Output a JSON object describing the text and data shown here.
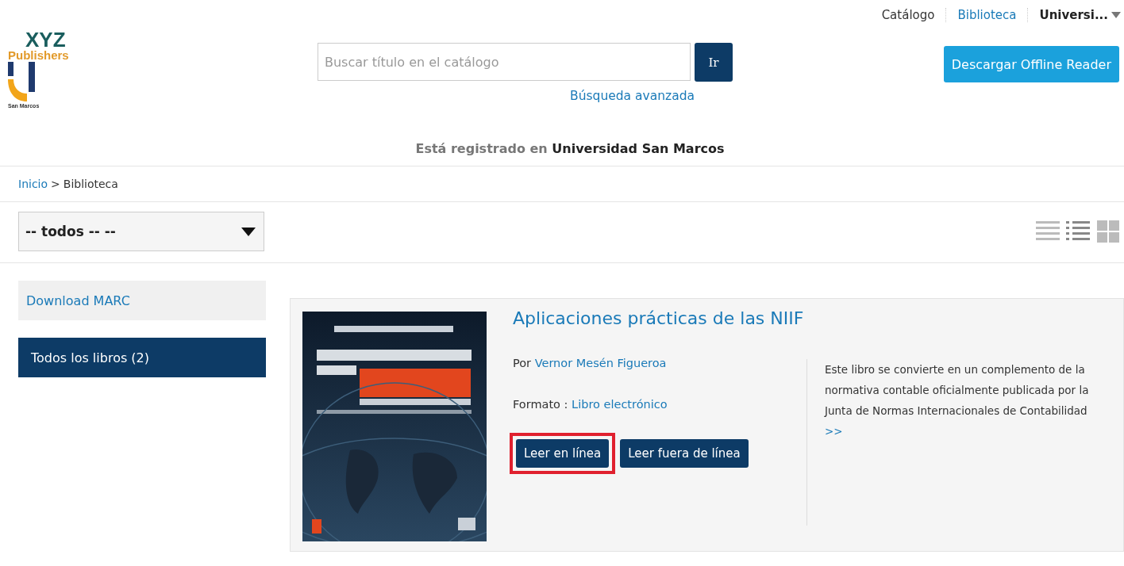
{
  "top_nav": [
    {
      "label": "Catálogo",
      "kind": "plain"
    },
    {
      "label": "Biblioteca",
      "kind": "link"
    },
    {
      "label": "Universi...",
      "kind": "menu"
    }
  ],
  "logo": {
    "brand": "XYZ",
    "sub": "Publishers",
    "institution": "San Marcos"
  },
  "search": {
    "placeholder": "Buscar título en el catálogo",
    "button": "Ir",
    "advanced": "Búsqueda avanzada"
  },
  "download_button": "Descargar Offline Reader",
  "registered": "Está registrado en **Universidad San Marcos**",
  "breadcrumb": [
    {
      "label": "Inicio",
      "kind": "link"
    },
    {
      "label": ">",
      "kind": "separator"
    },
    {
      "label": "Biblioteca",
      "kind": "current"
    }
  ],
  "filter": {
    "value": "-- todos -- --"
  },
  "views": [
    {
      "kind": "lines",
      "selected": false
    },
    {
      "kind": "bullets",
      "selected": true
    },
    {
      "kind": "grid",
      "selected": false
    }
  ],
  "sidebar": [
    {
      "label": "Download MARC",
      "selected": false
    },
    {
      "label": "Todos los libros (2)",
      "selected": true
    }
  ],
  "book": {
    "title": "Aplicaciones prácticas de las NIIF",
    "by_label": "Por",
    "author": "Vernor Mesén Figueroa",
    "format_label": "Formato :",
    "format": "Libro electrónico",
    "buttons": [
      {
        "label": "Leer en línea",
        "highlighted": true
      },
      {
        "label": "Leer fuera de línea",
        "highlighted": false
      }
    ],
    "description": "Este libro se convierte en un complemento de la normativa contable oficialmente publicada por la Junta de Normas Internacionales de Contabilidad",
    "more": ">>"
  }
}
